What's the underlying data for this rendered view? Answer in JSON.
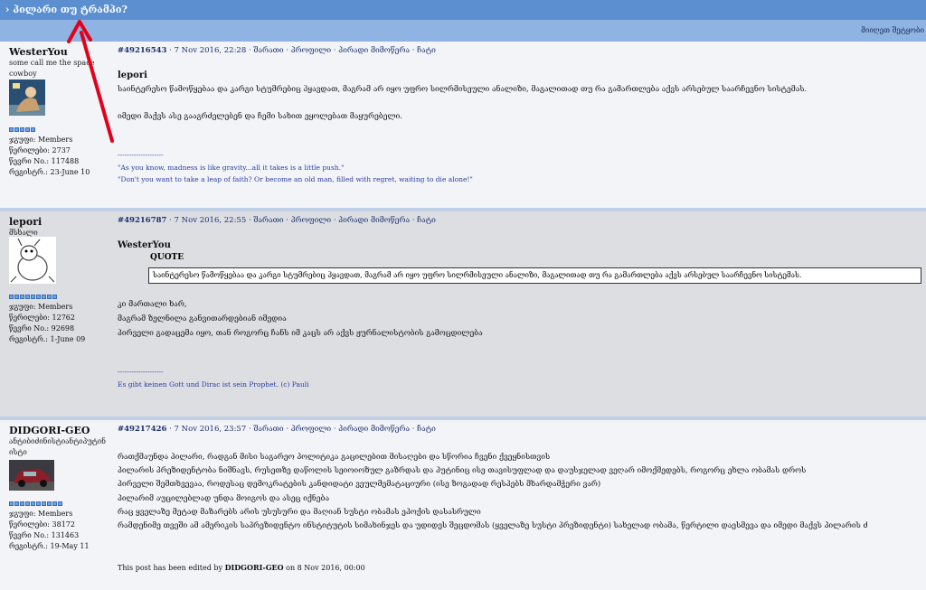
{
  "topic_title": "› პილარი თუ ტრამპი?",
  "subbar_right": "მიიღეთ შეტყობი",
  "posts": [
    {
      "author": "WesterYou",
      "author_title": [
        "some call me the space",
        "cowboy"
      ],
      "stats": [
        "ჯგუფი: Members",
        "წერილები: 2737",
        "წევრი No.: 117488",
        "რეგისტრ.: 23-June 10"
      ],
      "meta": {
        "id": "#49216543",
        "date": "7 Nov 2016, 22:28",
        "links": [
          "შარათი",
          "პროფილი",
          "პირადი მიმოწერა",
          "ჩატი"
        ]
      },
      "body_bold": "lepori",
      "body": [
        "საინტერესო წამოწყებაა და კარგი სტუმრებიც ჰყავდათ, მაგრამ არ იყო უფრო სილრმისეული ანალიზი, მაგალითად თუ რა გამართლება აქვს არსებულ საარჩევნო სისტემას.",
        "",
        "იმედი მაქვს ასე გააგრძელებენ და ჩემი სახით ეყოლებათ მაყურებელი."
      ],
      "signature": [
        "--------------------",
        "\"As you know, madness is like gravity...all it takes is a little push.\"",
        "\"Don't you want to take a leap of faith? Or become an old man, filled with regret, waiting to die alone!\""
      ]
    },
    {
      "author": "lepori",
      "author_title": [
        "მსხალი"
      ],
      "stats": [
        "ჯგუფი: Members",
        "წერილები: 12762",
        "წევრი No.: 92698",
        "რეგისტრ.: 1-June 09"
      ],
      "meta": {
        "id": "#49216787",
        "date": "7 Nov 2016, 22:55",
        "links": [
          "შარათი",
          "პროფილი",
          "პირადი მიმოწერა",
          "ჩატი"
        ]
      },
      "body_bold": "WesterYou",
      "quote_label": "QUOTE",
      "quote_text": "საინტერესო წამოწყებაა და კარგი სტუმრებიც ჰყავდათ, მაგრამ არ იყო უფრო სილრმისეული ანალიზი, მაგალითად თუ რა გამართლება აქვს არსებულ საარჩევნო სისტემას.",
      "body": [
        "კი მართალი ხარ,",
        "მაგრამ ზელნილა განვითარდებიან იმედია",
        "პირველი გადაცემა იყო, თან როგორც ჩანს იმ კაცს არ აქვს ჟურნალისტობის გამოცდილება"
      ],
      "signature": [
        "--------------------",
        "Es gibt keinen Gott und Dirac ist sein Prophet. (c) Pauli"
      ]
    },
    {
      "author": "DIDGORI-GEO",
      "author_title": [
        "ანტიბიძინისტიანტიპუტინ",
        "ისტი"
      ],
      "stats": [
        "ჯგუფი: Members",
        "წერილები: 38172",
        "წევრი No.: 131463",
        "რეგისტრ.: 19-May 11"
      ],
      "meta": {
        "id": "#49217426",
        "date": "7 Nov 2016, 23:57",
        "links": [
          "შარათი",
          "პროფილი",
          "პირადი მიმოწერა",
          "ჩატი"
        ]
      },
      "body": [
        "რათქმაუნდა პილარი, რადგან მისი საგარეო პოლიტიკა გაცილებით მისაღები და სწორია ჩვენი ქვეყნისთვის",
        "პილარის პრეზიდენტობა ნიშნავს, რუსეთზე დაწოლის სეიოიოზულ გაზრდას და პუტინიც ისე თავისუფლად და დაუსჯელად ვეღარ იმოქმედებს, როგორც ეხლა ობამას დროს",
        "პირველი შემთხვევაა, როდესაც დემოკრატების კანდიდატი ვეულმემატაციური (ისე ზოგადად რესპებს მხარდამჭერი ვარ)",
        "პილარიმ აუცილებლად უნდა მოიგოს და ასეც იქნება",
        "რაც ყველაზე მეტად მაზარებს არის უსუსური და მაღიან სუსტი ობამას ეპოქის დასასრული",
        "რამდენიმე თვეში ამ ამერიკის საპრეზიდენტო ინსტიტუტის სიმახინჯეს და უდიდეს შეცდომას (ყველაზე სუსტი პრეზიდენტი) სახელად ობამა, წერტილი დაესმევა და იმედი მაქვს პილარის ძ"
      ],
      "edited": [
        "This post has been edited by ",
        "DIDGORI-GEO",
        " on 8 Nov 2016, 00:00"
      ]
    }
  ],
  "colors": {
    "title_bar": "#5b8fd0",
    "sub_bar": "#8fb3e3",
    "link": "#1c2f70",
    "annotation_arrow": "#e3001b"
  },
  "icons": {
    "avatar1": "photo-avatar-icon",
    "avatar2": "cartoon-avatar-icon",
    "avatar3": "car-avatar-icon",
    "annotation": "red-arrow-annotation"
  }
}
